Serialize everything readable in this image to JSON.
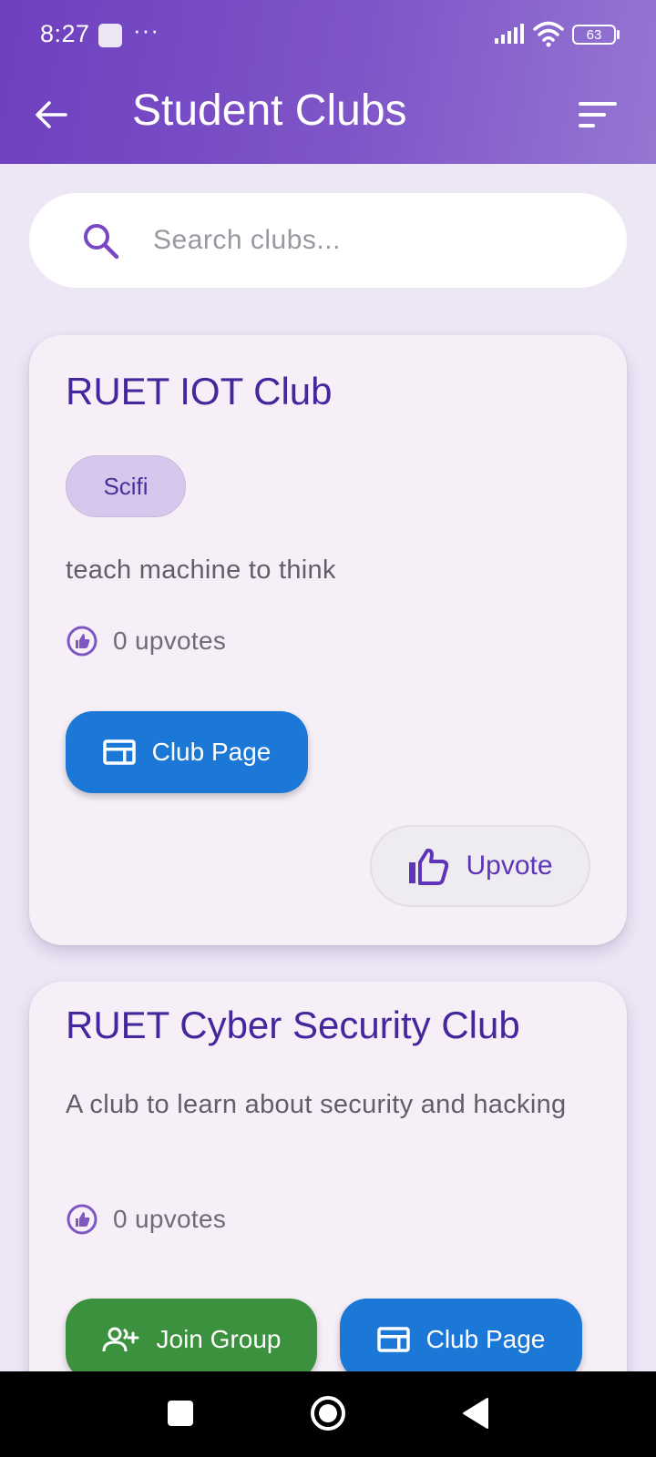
{
  "status_bar": {
    "time": "8:27",
    "overflow": "···",
    "battery": "63"
  },
  "header": {
    "title": "Student Clubs",
    "back_icon": "arrow-back-icon",
    "sort_icon": "sort-icon"
  },
  "search": {
    "placeholder": "Search clubs...",
    "value": "",
    "icon": "search-icon"
  },
  "clubs": [
    {
      "name": "RUET IOT Club",
      "tag": "Scifi",
      "description": "teach machine to think",
      "upvotes": "0 upvotes",
      "club_page_label": "Club Page",
      "upvote_label": "Upvote"
    },
    {
      "name": "RUET Cyber Security Club",
      "description": "A club to learn about security and hacking",
      "upvotes": "0 upvotes",
      "join_label": "Join Group",
      "club_page_label": "Club Page"
    }
  ],
  "colors": {
    "appbar_start": "#6e3fbf",
    "appbar_end": "#9476d2",
    "title_purple": "#45279d",
    "button_blue": "#1b78d6",
    "button_green": "#3b913e",
    "card_bg": "#f6eff8",
    "page_bg": "#ece6f5"
  }
}
